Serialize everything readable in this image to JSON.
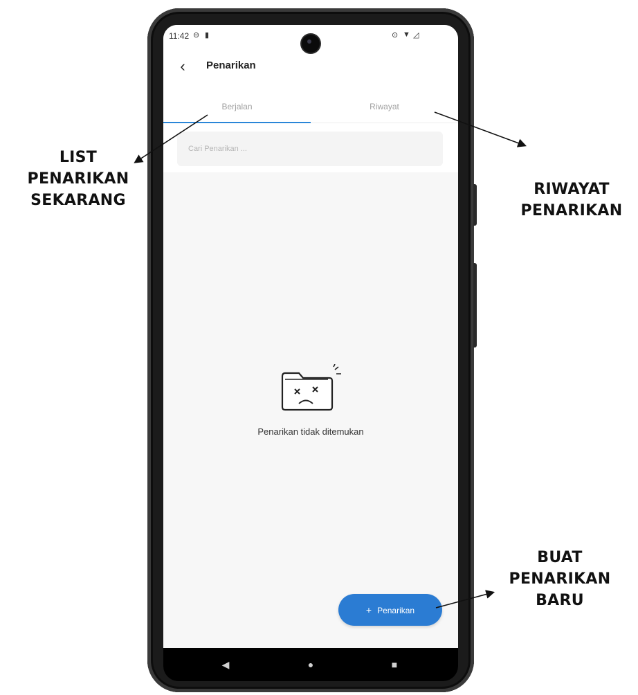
{
  "status_bar": {
    "time": "11:42",
    "icons": [
      "dnd-icon",
      "sd-card-icon",
      "location-icon",
      "wifi-icon",
      "signal-icon"
    ]
  },
  "app_bar": {
    "title": "Penarikan",
    "back_icon": "chevron-left-icon"
  },
  "tabs": [
    {
      "label": "Berjalan",
      "active": true
    },
    {
      "label": "Riwayat",
      "active": false
    }
  ],
  "search": {
    "placeholder": "Cari Penarikan ..."
  },
  "empty_state": {
    "icon": "sad-folder-icon",
    "message": "Penarikan tidak ditemukan"
  },
  "fab": {
    "icon": "plus-icon",
    "label": "Penarikan"
  },
  "navigation": {
    "icons": [
      "nav-back-icon",
      "nav-home-icon",
      "nav-recents-icon"
    ]
  },
  "annotations": {
    "list": [
      "LIST",
      "PENARIKAN",
      "SEKARANG"
    ],
    "riwayat": [
      "RIWAYAT",
      "PENARIKAN"
    ],
    "buat": [
      "BUAT",
      "PENARIKAN",
      "BARU"
    ]
  },
  "colors": {
    "accent": "#2b7cd3",
    "tab_indicator": "#2a86d8",
    "screen_background": "#f7f7f7",
    "phone_frame": "#1b1b1b"
  }
}
